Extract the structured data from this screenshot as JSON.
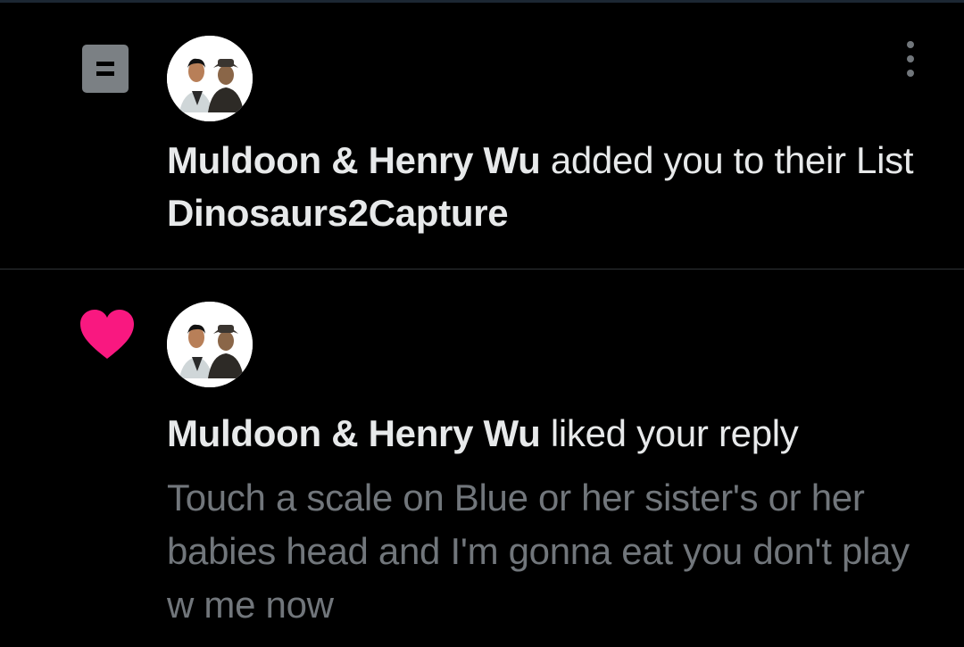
{
  "notifications": [
    {
      "type": "list",
      "type_icon": "list-icon",
      "actor": "Muldoon & Henry Wu",
      "action": " added you to their List ",
      "list_name": "Dinosaurs2Capture",
      "has_more_menu": true,
      "more_icon": "more-vertical-icon"
    },
    {
      "type": "like",
      "type_icon": "heart-icon",
      "actor": "Muldoon & Henry Wu",
      "action": " liked your reply",
      "reply_text": "Touch a scale on Blue or her sister's or her babies head and I'm gonna eat you don't play w me now"
    }
  ],
  "colors": {
    "background": "#000000",
    "primary_text": "#e7e9ea",
    "secondary_text": "#71767b",
    "divider": "#2f3336",
    "like_heart": "#f91880",
    "list_icon_bg": "#7b8084"
  }
}
